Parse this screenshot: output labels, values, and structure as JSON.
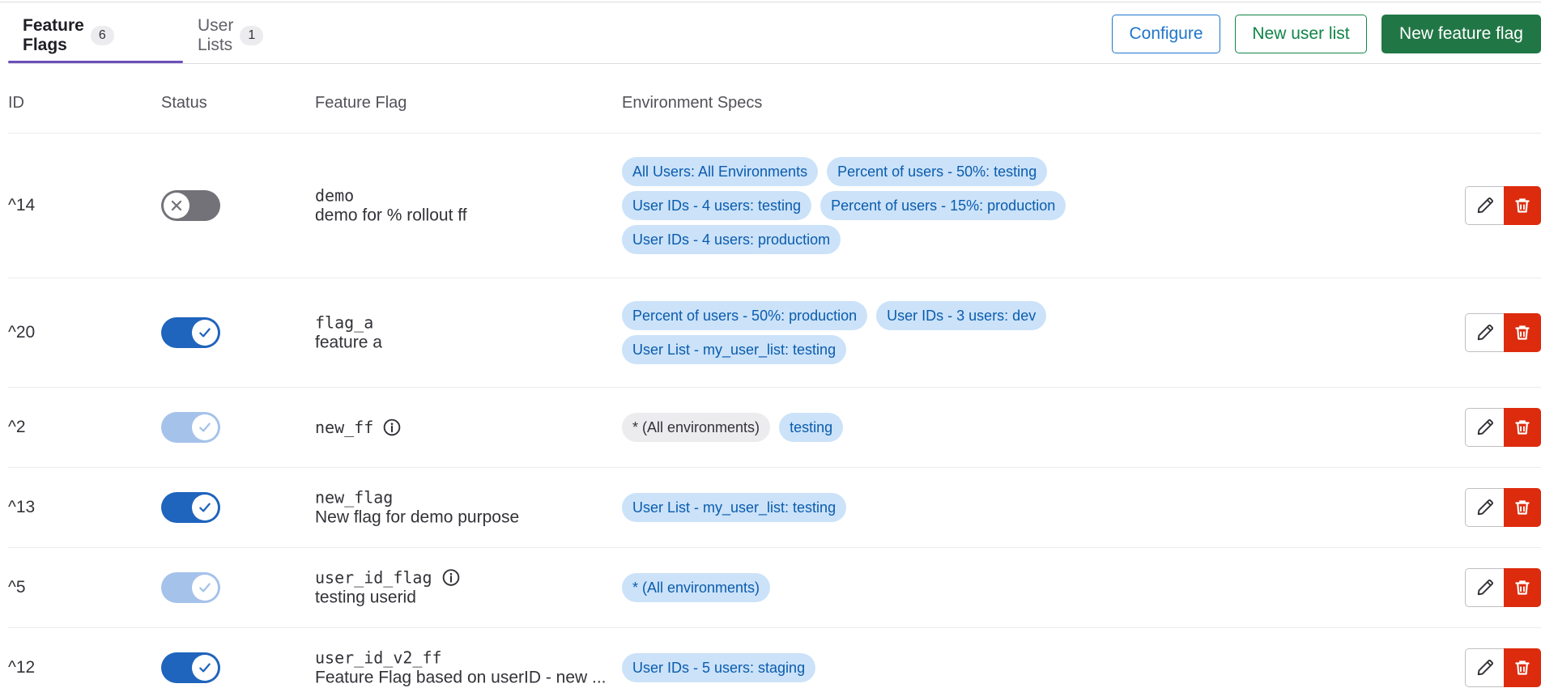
{
  "tabs": [
    {
      "label": "Feature Flags",
      "count": "6",
      "active": true
    },
    {
      "label": "User Lists",
      "count": "1",
      "active": false
    }
  ],
  "buttons": {
    "configure": "Configure",
    "new_user_list": "New user list",
    "new_feature_flag": "New feature flag"
  },
  "table": {
    "headers": [
      "ID",
      "Status",
      "Feature Flag",
      "Environment Specs"
    ],
    "rows": [
      {
        "id": "^14",
        "status": "off",
        "name": "demo",
        "description": "demo for % rollout ff",
        "has_info": false,
        "specs": [
          "All Users: All Environments",
          "Percent of users - 50%: testing",
          "User IDs - 4 users: testing",
          "Percent of users - 15%: production",
          "User IDs - 4 users: productiom"
        ]
      },
      {
        "id": "^20",
        "status": "on",
        "name": "flag_a",
        "description": "feature a",
        "has_info": false,
        "specs": [
          "Percent of users - 50%: production",
          "User IDs - 3 users: dev",
          "User List - my_user_list: testing"
        ]
      },
      {
        "id": "^2",
        "status": "disabled",
        "name": "new_ff",
        "description": "",
        "has_info": true,
        "specs": [
          "* (All environments)",
          "testing"
        ]
      },
      {
        "id": "^13",
        "status": "on",
        "name": "new_flag",
        "description": "New flag for demo purpose",
        "has_info": false,
        "specs": [
          "User List - my_user_list: testing"
        ]
      },
      {
        "id": "^5",
        "status": "disabled",
        "name": "user_id_flag",
        "description": "testing userid",
        "has_info": true,
        "specs": [
          "* (All environments)"
        ]
      },
      {
        "id": "^12",
        "status": "on",
        "name": "user_id_v2_ff",
        "description": "Feature Flag based on userID - new ...",
        "has_info": false,
        "specs": [
          "User IDs - 5 users: staging"
        ]
      }
    ]
  },
  "colors": {
    "primary_blue": "#1f75cb",
    "success_green": "#108548",
    "danger_red": "#dd2b0e",
    "tab_underline": "#6b4fbb",
    "chip_blue_bg": "#cbe2f9",
    "chip_neutral_bg": "#ececef"
  },
  "icons": {
    "edit": "pencil-icon",
    "delete": "trash-icon",
    "info": "information-o-icon",
    "toggle_on": "check-icon",
    "toggle_off": "close-icon"
  }
}
